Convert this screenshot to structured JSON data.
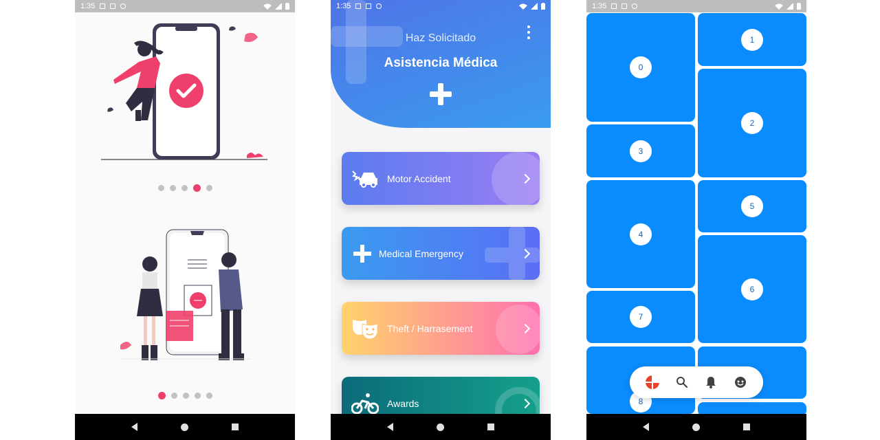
{
  "statusbar": {
    "time": "1:35"
  },
  "screen1": {
    "pager_top": {
      "count": 5,
      "active": 3
    },
    "pager_bottom": {
      "count": 5,
      "active": 0
    }
  },
  "screen2": {
    "header": {
      "subtitle": "Haz Solicitado",
      "title": "Asistencia Médica"
    },
    "cards": [
      {
        "label": "Motor Accident",
        "icon": "car-crash-icon"
      },
      {
        "label": "Medical Emergency",
        "icon": "plus-icon"
      },
      {
        "label": "Theft / Harrasement",
        "icon": "theater-masks-icon"
      },
      {
        "label": "Awards",
        "icon": "bicycle-icon"
      }
    ]
  },
  "screen3": {
    "tiles": [
      "0",
      "1",
      "2",
      "3",
      "4",
      "5",
      "6",
      "7",
      "8"
    ],
    "bottom_nav": [
      "pie-chart-icon",
      "search-icon",
      "bell-icon",
      "face-icon"
    ],
    "accent": "#0a8cff"
  },
  "colors": {
    "pink": "#ef3f6b",
    "card1": [
      "#5b7cf0",
      "#9b7df3"
    ],
    "card2": [
      "#3a9bf0",
      "#5a6ef5"
    ],
    "card3": [
      "#ffd36b",
      "#ff6fb0"
    ],
    "card4": [
      "#0b6b7a",
      "#15a08b"
    ]
  }
}
